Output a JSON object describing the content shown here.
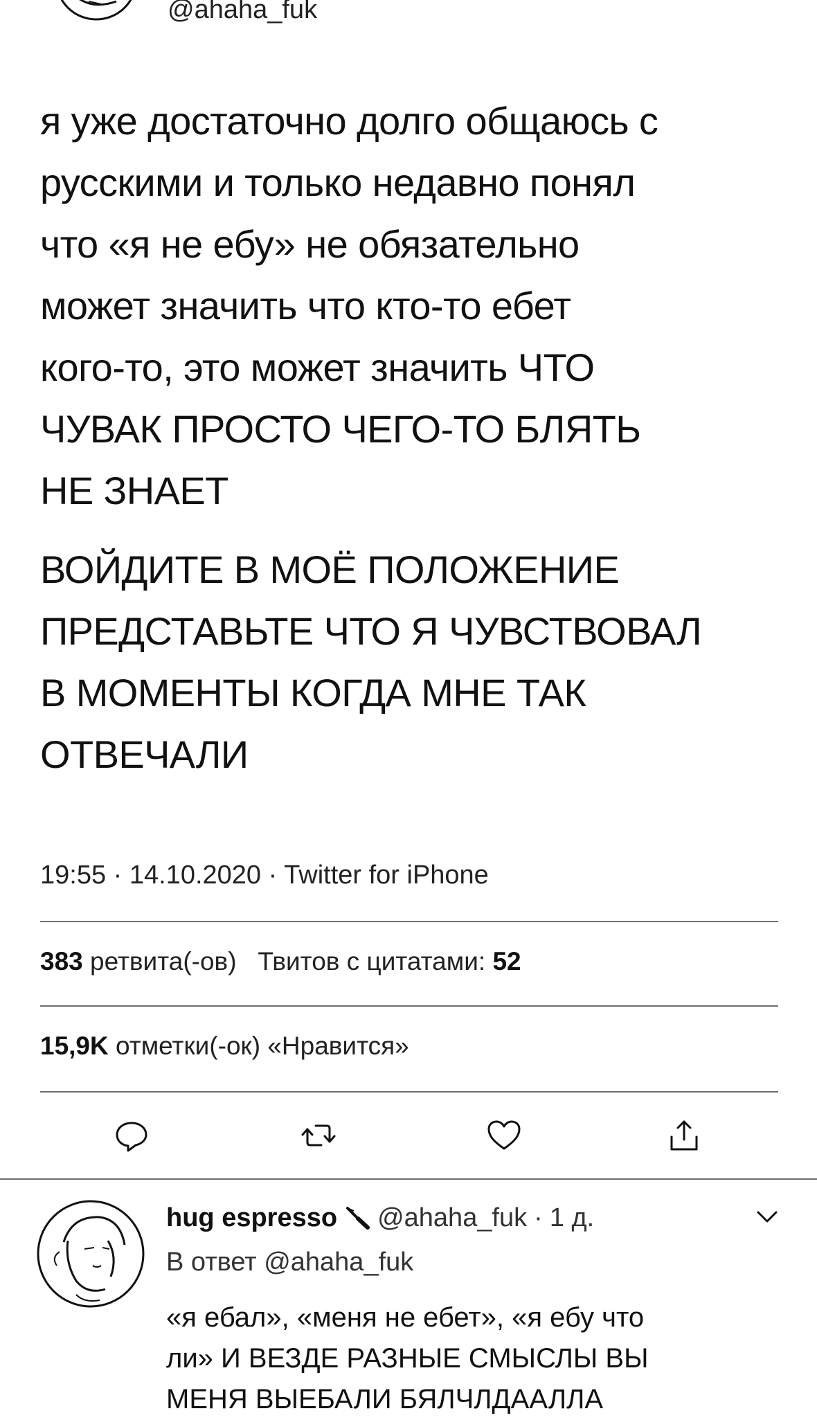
{
  "tweet": {
    "author_handle": "@ahaha_fuk",
    "paragraphs": [
      "я уже достаточно долго общаюсь с\nрусскими и только недавно понял\nчто «я не ебу» не обязательно\nможет значить что кто-то ебет\nкого-то, это может значить ЧТО\nЧУВАК ПРОСТО ЧЕГО-ТО БЛЯТЬ\nНЕ ЗНАЕТ",
      "ВОЙДИТЕ В МОЁ ПОЛОЖЕНИЕ\nПРЕДСТАВЬТЕ ЧТО Я ЧУВСТВОВАЛ\nВ МОМЕНТЫ КОГДА МНЕ ТАК\nОТВЕЧАЛИ"
    ],
    "meta": "19:55 · 14.10.2020 · Twitter for iPhone",
    "retweets_count": "383",
    "retweets_label": "ретвита(-ов)",
    "quotes_label": "Твитов с цитатами:",
    "quotes_count": "52",
    "likes_count": "15,9K",
    "likes_label": "отметки(-ок) «Нравится»"
  },
  "actions": {
    "reply_icon": "speech-bubble",
    "retweet_icon": "retweet-arrows",
    "like_icon": "heart",
    "share_icon": "share-upload"
  },
  "reply": {
    "display_name": "hug espresso",
    "name_emoji": "knife",
    "handle": "@ahaha_fuk",
    "time": "1 д.",
    "reply_to": "В ответ @ahaha_fuk",
    "text": "«я ебал», «меня не ебет», «я ебу что\nли» И ВЕЗДЕ РАЗНЫЕ СМЫСЛЫ ВЫ\nМЕНЯ ВЫЕБАЛИ БЯЛЧЛДААЛЛА"
  },
  "colors": {
    "text": "#111111",
    "divider": "#6e6e6e",
    "background": "#ffffff"
  }
}
